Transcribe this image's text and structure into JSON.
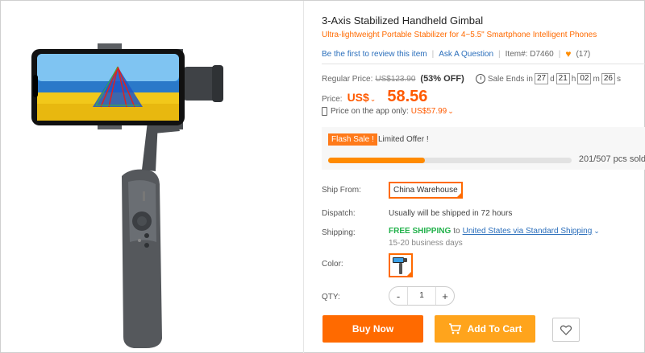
{
  "product": {
    "title": "3-Axis Stabilized Handheld Gimbal",
    "subtitle": "Ultra-lightweight Portable Stabilizer for 4~5.5\" Smartphone Intelligent Phones",
    "review_link": "Be the first to review this item",
    "ask_link": "Ask A Question",
    "item_number": "Item#: D7460",
    "favorites": "(17)",
    "image_icon": "gimbal-product-image"
  },
  "pricing": {
    "regular_label": "Regular Price:",
    "regular_price": "US$123.90",
    "discount": "(53% OFF)",
    "sale_label": "Sale Ends in",
    "countdown": {
      "days": "27",
      "hours": "21",
      "minutes": "02",
      "seconds": "26"
    },
    "price_label": "Price:",
    "currency": "US$",
    "price": "58.56",
    "app_label": "Price on the app only:",
    "app_price": "US$57.99"
  },
  "flash_sale": {
    "badge": "Flash Sale !",
    "text": "Limited Offer !",
    "sold": "201/507 pcs sold",
    "progress_fraction": 0.396
  },
  "shipping": {
    "ship_from_label": "Ship From:",
    "ship_from_value": "China Warehouse",
    "dispatch_label": "Dispatch:",
    "dispatch_value": "Usually will be shipped in 72 hours",
    "shipping_label": "Shipping:",
    "free_shipping": "FREE SHIPPING",
    "to": "to",
    "destination": "United States via Standard Shipping",
    "days": "15-20 business days"
  },
  "options": {
    "color_label": "Color:",
    "qty_label": "QTY:",
    "qty_minus": "-",
    "qty_value": "1",
    "qty_plus": "+"
  },
  "actions": {
    "buy_now": "Buy Now",
    "add_to_cart": "Add To Cart"
  },
  "colors": {
    "accent": "#ff6a00",
    "cart": "#ffa41c",
    "free": "#21b14a",
    "link": "#2a6ebb"
  }
}
